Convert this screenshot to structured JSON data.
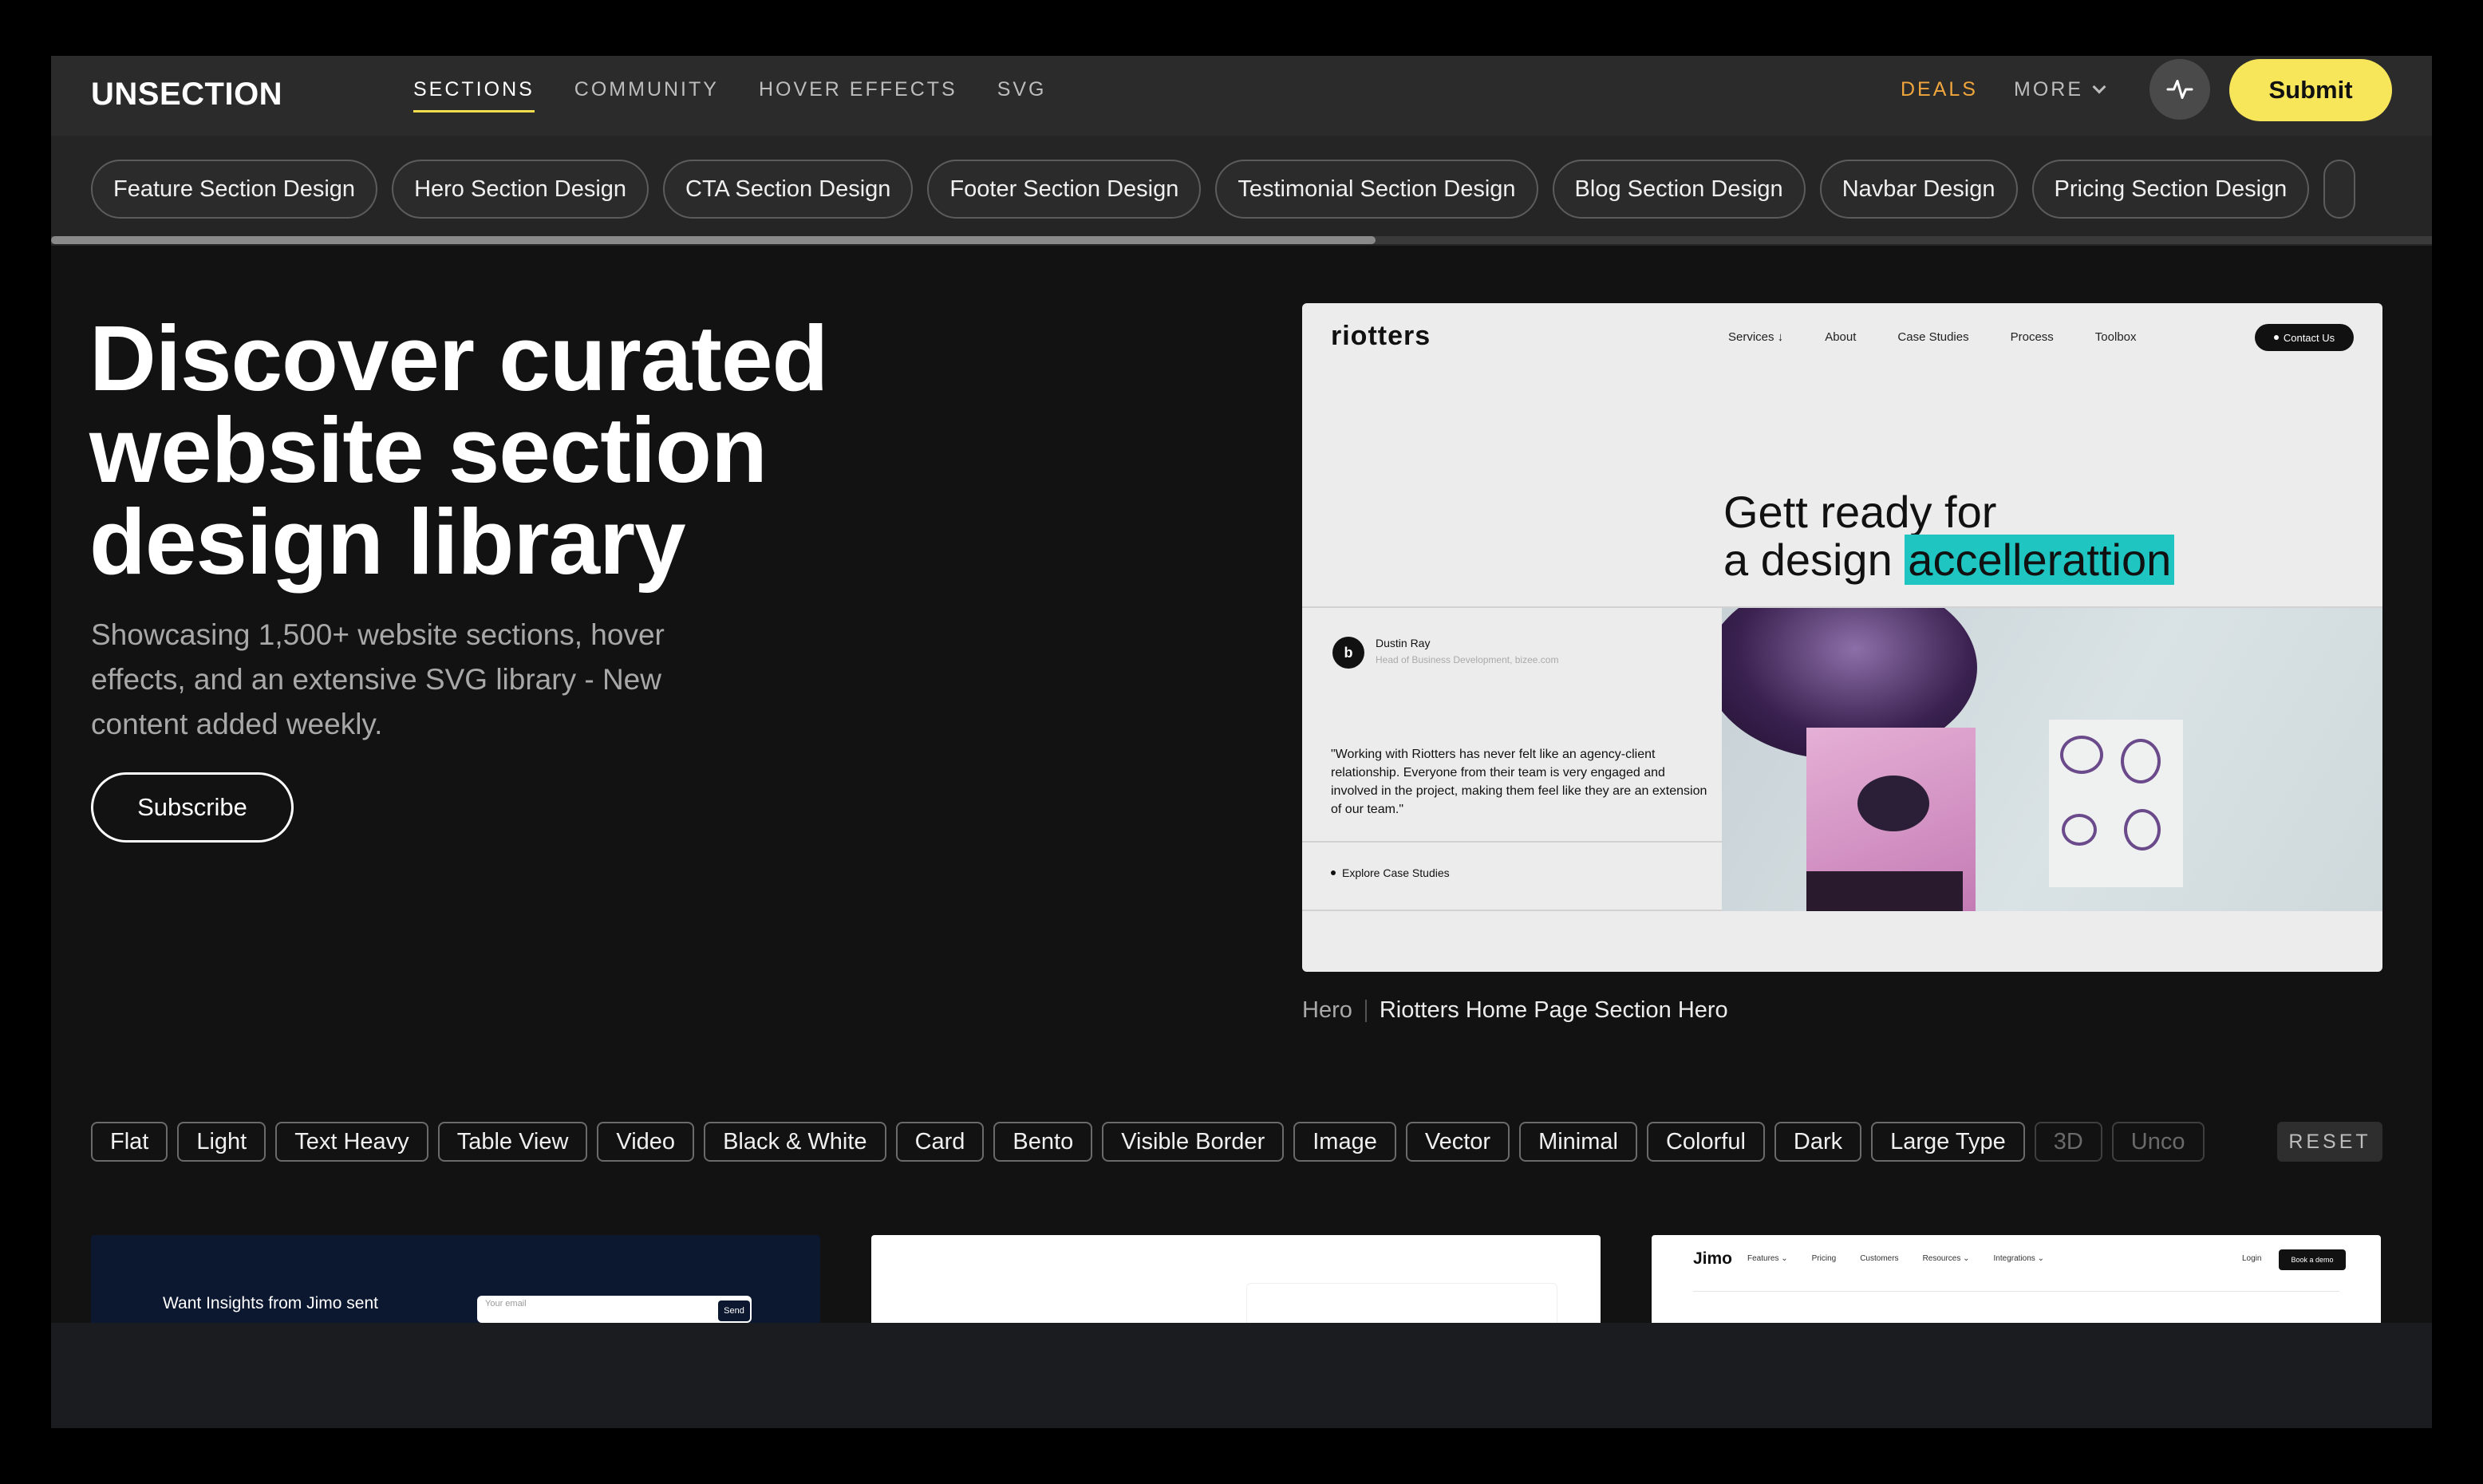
{
  "nav": {
    "logo": "UNSECTION",
    "links": [
      "SECTIONS",
      "COMMUNITY",
      "HOVER EFFECTS",
      "SVG"
    ],
    "active": "SECTIONS",
    "deals": "DEALS",
    "more": "MORE",
    "submit": "Submit",
    "deals_color": "#f0a63c",
    "submit_color": "#f7e55a"
  },
  "categories": [
    "Feature Section Design",
    "Hero Section Design",
    "CTA Section Design",
    "Footer Section Design",
    "Testimonial Section Design",
    "Blog Section Design",
    "Navbar Design",
    "Pricing Section Design"
  ],
  "hero": {
    "title": "Discover curated website section design library",
    "subtitle": "Showcasing 1,500+ website sections, hover effects, and an extensive SVG library - New content added weekly.",
    "subscribe": "Subscribe"
  },
  "preview": {
    "logo": "riotters",
    "nav": [
      "Services ↓",
      "About",
      "Case Studies",
      "Process",
      "Toolbox"
    ],
    "contact": "Contact Us",
    "headline_line1": "Gett ready for",
    "headline_line2_plain": "a design",
    "headline_highlight": "accellerattion",
    "highlight_color": "#1fc5c0",
    "avatar_letter": "b",
    "person_name": "Dustin Ray",
    "person_role": "Head of Business Development, bizee.com",
    "quote": "\"Working with Riotters has never felt like an agency-client relationship. Everyone from their team is very engaged and involved in the project, making them feel like they are an extension of our team.\"",
    "explore": "Explore Case Studies"
  },
  "caption": {
    "tag": "Hero",
    "name": "Riotters Home Page Section Hero"
  },
  "filters": [
    "Flat",
    "Light",
    "Text Heavy",
    "Table View",
    "Video",
    "Black & White",
    "Card",
    "Bento",
    "Visible Border",
    "Image",
    "Vector",
    "Minimal",
    "Colorful",
    "Dark",
    "Large Type",
    "3D",
    "Unco"
  ],
  "filters_dimmed": [
    "3D",
    "Unco"
  ],
  "reset": "RESET",
  "thumbs": {
    "t1_text": "Want Insights from Jimo sent",
    "t1_input_placeholder": "Your email",
    "t1_send": "Send",
    "t3_logo": "Jimo",
    "t3_nav": [
      "Features ⌄",
      "Pricing",
      "Customers",
      "Resources ⌄",
      "Integrations ⌄"
    ],
    "t3_login": "Login",
    "t3_demo": "Book a demo"
  }
}
